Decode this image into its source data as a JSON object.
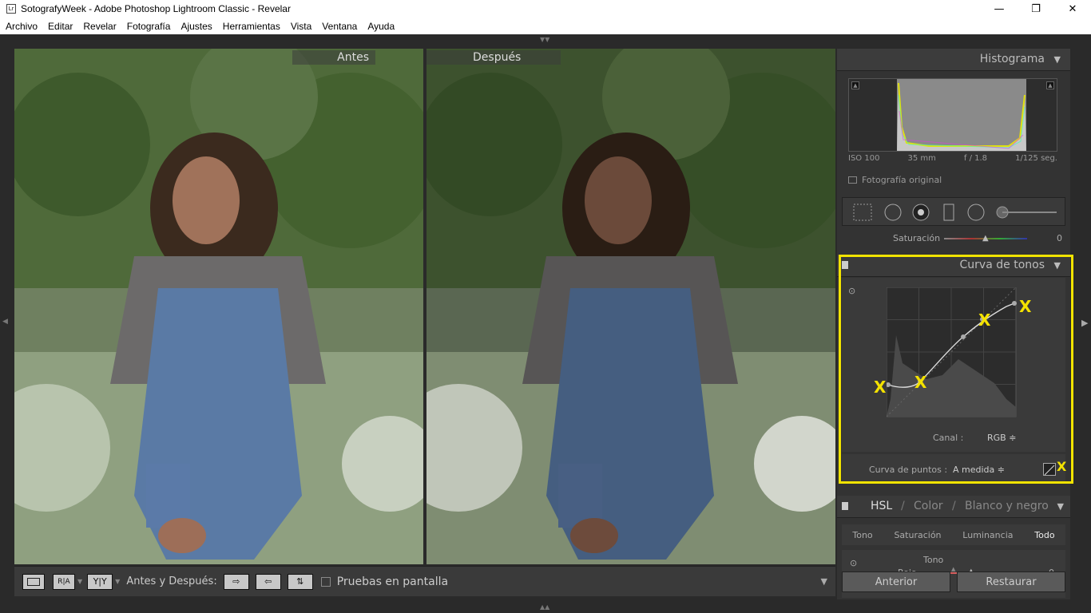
{
  "window": {
    "title": "SotografyWeek - Adobe Photoshop Lightroom Classic - Revelar",
    "logo": "Lr"
  },
  "menu": [
    "Archivo",
    "Editar",
    "Revelar",
    "Fotografía",
    "Ajustes",
    "Herramientas",
    "Vista",
    "Ventana",
    "Ayuda"
  ],
  "views": {
    "before_label": "Antes",
    "after_label": "Después"
  },
  "toolbar": {
    "ab_label": "Antes y Después:",
    "soft_proof": "Pruebas en pantalla"
  },
  "histogram": {
    "title": "Histograma",
    "iso": "ISO 100",
    "focal": "35 mm",
    "aperture": "f / 1.8",
    "shutter": "1/125 seg.",
    "original": "Fotografía original"
  },
  "saturation": {
    "label": "Saturación",
    "value": "0"
  },
  "tone_curve": {
    "title": "Curva de tonos",
    "channel_label": "Canal :",
    "channel_value": "RGB ≑",
    "point_curve_label": "Curva de puntos :",
    "point_curve_value": "A medida ≑",
    "marker": "X"
  },
  "hsl": {
    "title_hsl": "HSL",
    "sep1": "/",
    "title_color": "Color",
    "sep2": "/",
    "title_bw": "Blanco y negro",
    "tabs": [
      "Tono",
      "Saturación",
      "Luminancia",
      "Todo"
    ],
    "section": "Tono",
    "row_label": "Rojo",
    "row_value": "0"
  },
  "footer": {
    "previous": "Anterior",
    "reset": "Restaurar"
  }
}
